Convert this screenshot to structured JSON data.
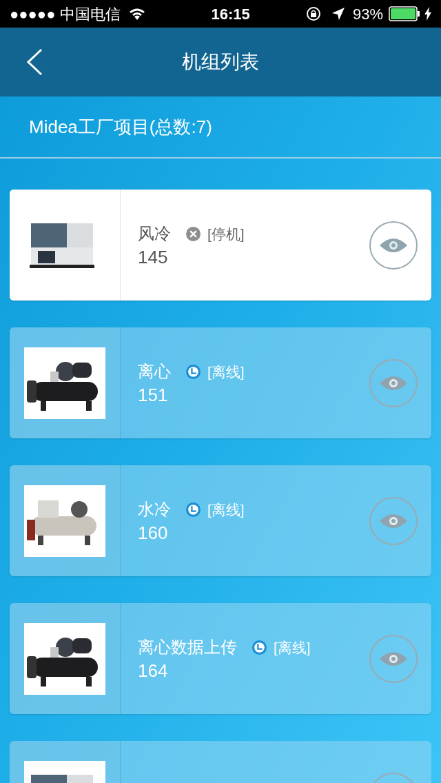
{
  "status_bar": {
    "carrier": "●●●●● 中国电信",
    "time": "16:15",
    "battery": "93%"
  },
  "nav": {
    "title": "机组列表"
  },
  "project": {
    "title": "Midea工厂项目(总数:7)"
  },
  "units": [
    {
      "name": "风冷",
      "number": "145",
      "status": "[停机]",
      "kind": "stopped",
      "selected": true
    },
    {
      "name": "离心",
      "number": "151",
      "status": "[离线]",
      "kind": "offline",
      "selected": false
    },
    {
      "name": "水冷",
      "number": "160",
      "status": "[离线]",
      "kind": "offline",
      "selected": false
    },
    {
      "name": "离心数据上传",
      "number": "164",
      "status": "[离线]",
      "kind": "offline",
      "selected": false
    }
  ]
}
